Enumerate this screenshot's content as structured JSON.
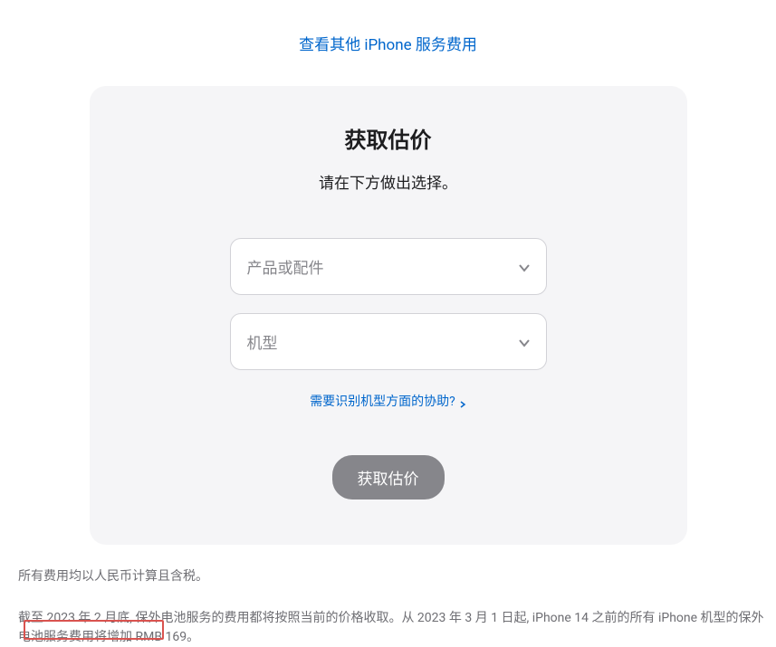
{
  "header": {
    "other_services_link": "查看其他 iPhone 服务费用"
  },
  "card": {
    "title": "获取估价",
    "subtitle": "请在下方做出选择。",
    "select_product_placeholder": "产品或配件",
    "select_model_placeholder": "机型",
    "help_link": "需要识别机型方面的协助?",
    "button_label": "获取估价"
  },
  "footer": {
    "line1": "所有费用均以人民币计算且含税。",
    "line2": "截至 2023 年 2 月底, 保外电池服务的费用都将按照当前的价格收取。从 2023 年 3 月 1 日起, iPhone 14 之前的所有 iPhone 机型的保外电池服务费用将增加 RMB 169。"
  }
}
